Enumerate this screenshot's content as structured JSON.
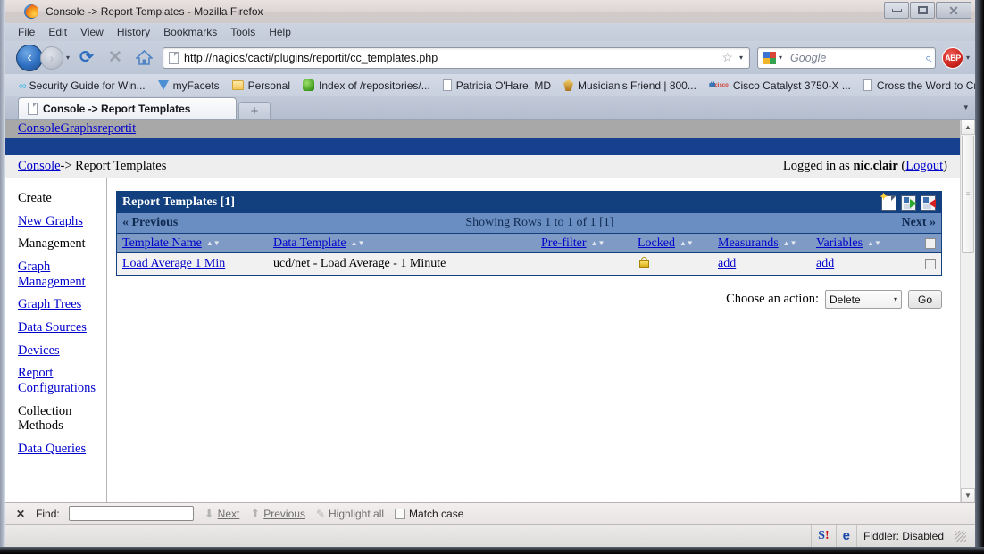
{
  "window": {
    "title": "Console -> Report Templates - Mozilla Firefox",
    "minimize_label": "Minimize",
    "maximize_label": "Maximize",
    "close_label": "Close"
  },
  "menubar": {
    "items": [
      "File",
      "Edit",
      "View",
      "History",
      "Bookmarks",
      "Tools",
      "Help"
    ]
  },
  "toolbar": {
    "back_label": "‹",
    "forward_label": "›",
    "dropdown_caret": "▾",
    "reload_label": "⟳",
    "stop_label": "✕",
    "home_label": "Home",
    "url": "http://nagios/cacti/plugins/reportit/cc_templates.php",
    "star_label": "☆",
    "search_placeholder": "Google",
    "search_magnifier": "⌕",
    "adblock_label": "ABP"
  },
  "bookmarks": {
    "items": [
      {
        "label": "Security Guide for Win...",
        "icon": "chain-icon"
      },
      {
        "label": "myFacets",
        "icon": "diamond-icon"
      },
      {
        "label": "Personal",
        "icon": "folder-icon"
      },
      {
        "label": "Index of /repositories/...",
        "icon": "green-orb-icon"
      },
      {
        "label": "Patricia O'Hare, MD",
        "icon": "page-icon"
      },
      {
        "label": "Musician's Friend | 800...",
        "icon": "guitar-pick-icon"
      },
      {
        "label": "Cisco Catalyst 3750-X ...",
        "icon": "cisco-icon"
      },
      {
        "label": "Cross the Word to Cro...",
        "icon": "page-icon"
      }
    ],
    "overflow_label": "»"
  },
  "tabs": {
    "active_title": "Console -> Report Templates",
    "new_tab_label": "+",
    "list_caret": "▾"
  },
  "cacti": {
    "topnav": [
      {
        "label": "Console"
      },
      {
        "label": "Graphs"
      },
      {
        "label": "reportit"
      }
    ],
    "breadcrumb_link": "Console",
    "breadcrumb_rest": " -> Report Templates",
    "login_prefix": "Logged in as ",
    "login_user": "nic.clair",
    "login_open_paren": " (",
    "logout_label": "Logout",
    "login_close_paren": ")"
  },
  "sidebar": {
    "groups": [
      {
        "heading": "Create",
        "links": [
          "New Graphs"
        ]
      },
      {
        "heading": "Management",
        "links": [
          "Graph Management",
          "Graph Trees",
          "Data Sources",
          "Devices",
          "Report Configurations"
        ]
      },
      {
        "heading": "Collection Methods",
        "links": [
          "Data Queries"
        ]
      }
    ]
  },
  "table": {
    "title": "Report Templates [1]",
    "header_icons": [
      {
        "name": "new-template-icon",
        "title": "New"
      },
      {
        "name": "import-icon",
        "title": "Import"
      },
      {
        "name": "export-icon",
        "title": "Export"
      }
    ],
    "pager": {
      "previous": "« Previous",
      "showing": "Showing Rows 1 to 1 of 1 [",
      "page_number": "1",
      "showing_suffix": "]",
      "next": "Next »"
    },
    "columns": [
      {
        "label": "Template Name",
        "sort": "▲▼"
      },
      {
        "label": "Data Template",
        "sort": "▲▼"
      },
      {
        "label": "Pre-filter",
        "sort": "▲▼"
      },
      {
        "label": "Locked",
        "sort": "▲▼"
      },
      {
        "label": "Measurands",
        "sort": "▲▼"
      },
      {
        "label": "Variables",
        "sort": "▲▼"
      }
    ],
    "rows": [
      {
        "template_name": "Load Average 1 Min",
        "data_template": "ucd/net - Load Average - 1 Minute",
        "pre_filter": "",
        "locked": "locked-icon",
        "measurands": "add",
        "variables": "add",
        "selected": false
      }
    ]
  },
  "actions": {
    "label": "Choose an action:",
    "selected": "Delete",
    "options": [
      "Delete"
    ],
    "caret": "▾",
    "go_label": "Go"
  },
  "findbar": {
    "close_label": "✕",
    "label": "Find:",
    "value": "",
    "next_label": "Next",
    "previous_label": "Previous",
    "highlight_label": "Highlight all",
    "match_case_label": "Match case",
    "match_case_checked": false
  },
  "statusbar": {
    "icon1": "S!",
    "icon2": "e",
    "fiddler": "Fiddler: Disabled"
  },
  "scrollbar": {
    "up_arrow": "▲",
    "down_arrow": "▼",
    "grip": "≡"
  },
  "colors": {
    "cacti_dark_blue": "#12407f",
    "cacti_pager_blue": "#6a8ec1",
    "cacti_colhead_blue": "#7f9ac4",
    "cacti_topbar_blue": "#17418f",
    "link_blue": "#0000cc",
    "row_gray": "#f1f1f1"
  }
}
